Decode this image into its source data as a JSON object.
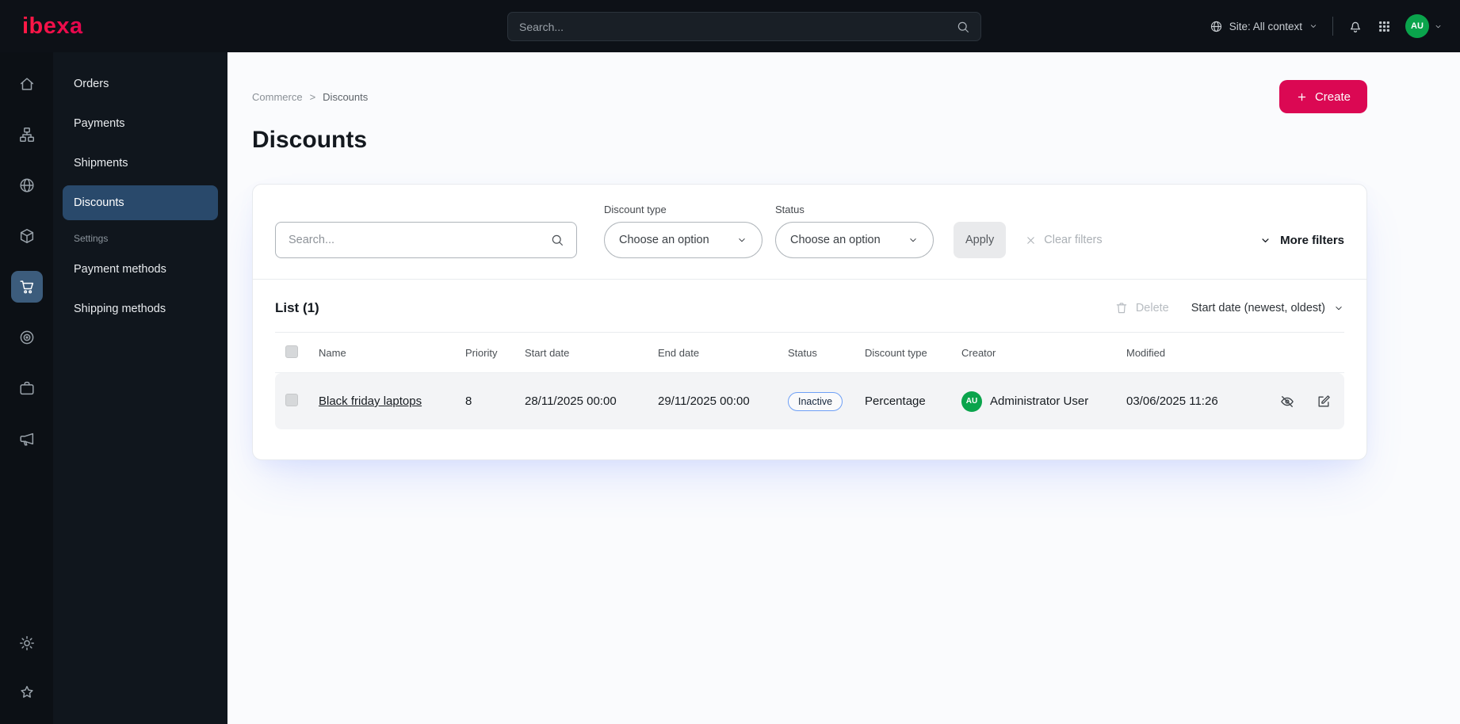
{
  "topbar": {
    "logo": "ibexa",
    "search_placeholder": "Search...",
    "site_context": "Site: All context",
    "avatar_initials": "AU"
  },
  "sidebar": {
    "menu_items": [
      {
        "label": "Orders"
      },
      {
        "label": "Payments"
      },
      {
        "label": "Shipments"
      },
      {
        "label": "Discounts"
      }
    ],
    "settings_label": "Settings",
    "settings_items": [
      {
        "label": "Payment methods"
      },
      {
        "label": "Shipping methods"
      }
    ]
  },
  "main": {
    "breadcrumb": {
      "parent": "Commerce",
      "separator": ">",
      "current": "Discounts"
    },
    "create_button": "Create",
    "page_title": "Discounts",
    "filters": {
      "search_placeholder": "Search...",
      "discount_type_label": "Discount type",
      "discount_type_value": "Choose an option",
      "status_label": "Status",
      "status_value": "Choose an option",
      "apply_label": "Apply",
      "clear_label": "Clear filters",
      "more_filters_label": "More filters"
    },
    "list": {
      "title": "List (1)",
      "delete_label": "Delete",
      "sort_label": "Start date (newest, oldest)",
      "columns": [
        "Name",
        "Priority",
        "Start date",
        "End date",
        "Status",
        "Discount type",
        "Creator",
        "Modified"
      ],
      "rows": [
        {
          "name": "Black friday laptops",
          "priority": "8",
          "start_date": "28/11/2025 00:00",
          "end_date": "29/11/2025 00:00",
          "status": "Inactive",
          "discount_type": "Percentage",
          "creator_initials": "AU",
          "creator": "Administrator User",
          "modified": "03/06/2025 11:26"
        }
      ]
    }
  },
  "colors": {
    "accent_pink": "#db0853",
    "topbar_bg": "#0d1117",
    "sidebar_active_bg": "#29496b",
    "rail_active_bg": "#3c5c7c",
    "avatar_green": "#0aa44c",
    "status_inactive_border": "#6d9ff5",
    "row_bg": "#f3f4f6"
  },
  "icons": {
    "topbar": [
      "search-icon",
      "globe-icon",
      "chevron-down-icon",
      "bell-icon",
      "app-grid-icon"
    ],
    "rail": [
      "home-icon",
      "content-tree-icon",
      "site-globe-icon",
      "products-box-icon",
      "commerce-cart-icon",
      "personalization-target-icon",
      "corporate-briefcase-icon",
      "marketing-megaphone-icon",
      "settings-gear-icon",
      "bookmarks-star-icon"
    ],
    "filters": [
      "search-icon",
      "chevron-down-icon",
      "clear-x-icon"
    ],
    "list": [
      "trash-icon",
      "chevron-down-icon",
      "deactivate-icon",
      "edit-icon",
      "plus-icon"
    ]
  }
}
